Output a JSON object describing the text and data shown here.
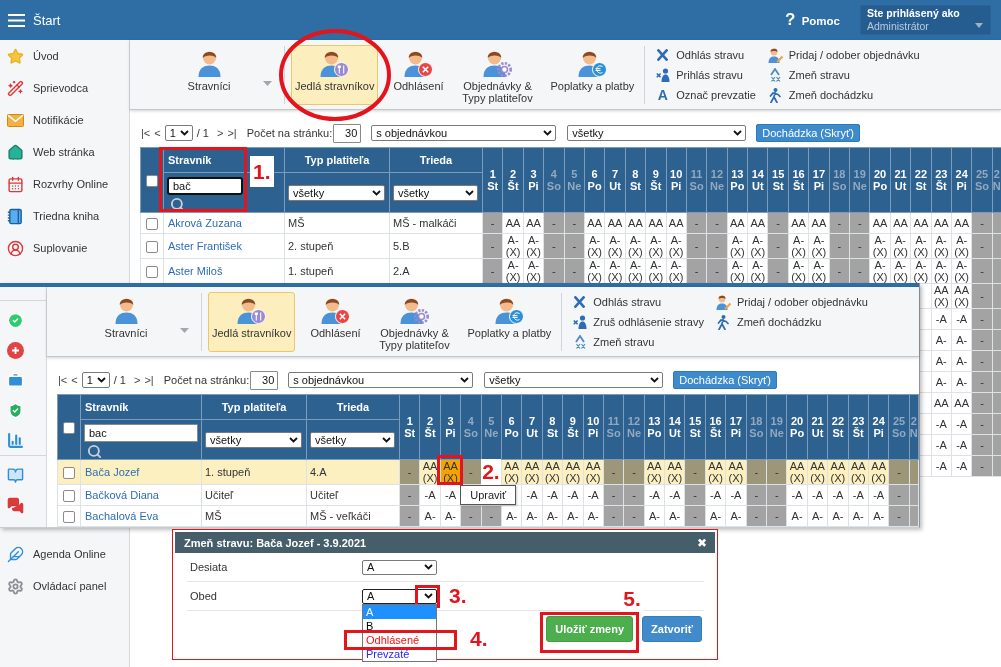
{
  "header": {
    "title": "Štart",
    "help_icon": "?",
    "help": "Pomoc",
    "user_caption": "Ste prihlásený ako",
    "user_name": "Administrátor"
  },
  "sidebar": {
    "items": [
      {
        "label": "Úvod"
      },
      {
        "label": "Sprievodca"
      },
      {
        "label": "Notifikácie"
      },
      {
        "label": "Web stránka"
      },
      {
        "label": "Rozvrhy Online"
      },
      {
        "label": "Triedna kniha"
      },
      {
        "label": "Suplovanie"
      }
    ],
    "bottom_items": [
      {
        "label": "Agenda Online"
      },
      {
        "label": "Ovládací panel"
      }
    ]
  },
  "base": {
    "toolbar": {
      "modules": [
        {
          "label": "Stravníci",
          "selected": false,
          "has_menu": true,
          "circled": false
        },
        {
          "label": "Jedlá stravníkov",
          "selected": true,
          "has_menu": false,
          "circled": true
        },
        {
          "label": "Odhlásení",
          "selected": false,
          "has_menu": false,
          "circled": false
        },
        {
          "label": "Objednávky & Typy platiteľov",
          "selected": false,
          "has_menu": false,
          "circled": false
        },
        {
          "label": "Poplatky a platby",
          "selected": false,
          "has_menu": false,
          "circled": false
        }
      ],
      "actions": [
        [
          {
            "label": "Odhlás stravu",
            "kind": "cancel"
          },
          {
            "label": "Prihlás stravu",
            "kind": "restore"
          },
          {
            "label": "Označ prevzatie",
            "kind": "mark",
            "glyph": "A"
          }
        ],
        [
          {
            "label": "Pridaj / odober objednávku",
            "kind": "order"
          },
          {
            "label": "Zmeň stravu",
            "kind": "change"
          },
          {
            "label": "Zmeň dochádzku",
            "kind": "attendance"
          }
        ]
      ]
    },
    "pager": {
      "first": "|<",
      "prev": "<",
      "page": "1",
      "of": "/ 1",
      "next": ">",
      "last": ">|",
      "per_page_label": "Počet na stránku:",
      "per_page": "30",
      "order_filter": "s objednávkou",
      "status_filter": "všetky",
      "attendance_button": "Dochádzka (Skryť)"
    },
    "table": {
      "columns": {
        "name": "Stravník",
        "payer_type": "Typ platiteľa",
        "class": "Trieda"
      },
      "select_all": false,
      "filters": {
        "name": "bač",
        "focused": true,
        "step": "1.",
        "payer_type": "všetky",
        "class": "všetky"
      },
      "days": [
        {
          "num": "1",
          "dow": "St",
          "kind": "holiday"
        },
        {
          "num": "2",
          "dow": "Št",
          "kind": "workday"
        },
        {
          "num": "3",
          "dow": "Pi",
          "kind": "workday"
        },
        {
          "num": "4",
          "dow": "So",
          "kind": "weekend"
        },
        {
          "num": "5",
          "dow": "Ne",
          "kind": "weekend"
        },
        {
          "num": "6",
          "dow": "Po",
          "kind": "workday"
        },
        {
          "num": "7",
          "dow": "Ut",
          "kind": "workday"
        },
        {
          "num": "8",
          "dow": "St",
          "kind": "workday"
        },
        {
          "num": "9",
          "dow": "Št",
          "kind": "workday"
        },
        {
          "num": "10",
          "dow": "Pi",
          "kind": "workday"
        },
        {
          "num": "11",
          "dow": "So",
          "kind": "weekend"
        },
        {
          "num": "12",
          "dow": "Ne",
          "kind": "weekend"
        },
        {
          "num": "13",
          "dow": "Po",
          "kind": "workday"
        },
        {
          "num": "14",
          "dow": "Ut",
          "kind": "workday"
        },
        {
          "num": "15",
          "dow": "St",
          "kind": "holiday"
        },
        {
          "num": "16",
          "dow": "Št",
          "kind": "workday"
        },
        {
          "num": "17",
          "dow": "Pi",
          "kind": "workday"
        },
        {
          "num": "18",
          "dow": "So",
          "kind": "weekend"
        },
        {
          "num": "19",
          "dow": "Ne",
          "kind": "weekend"
        },
        {
          "num": "20",
          "dow": "Po",
          "kind": "workday"
        },
        {
          "num": "21",
          "dow": "Ut",
          "kind": "workday"
        },
        {
          "num": "22",
          "dow": "St",
          "kind": "workday"
        },
        {
          "num": "23",
          "dow": "Št",
          "kind": "workday"
        },
        {
          "num": "24",
          "dow": "Pi",
          "kind": "workday"
        },
        {
          "num": "25",
          "dow": "So",
          "kind": "weekend"
        },
        {
          "num": "2",
          "dow": "N",
          "kind": "weekend"
        }
      ],
      "rows": [
        {
          "name": "Akrová Zuzana",
          "payer_type": "MŠ",
          "class": "MŠ - malkáči",
          "checked": false,
          "days": [
            "-",
            "AA",
            "AA",
            "-",
            "-",
            "AA",
            "AA",
            "AA",
            "AA",
            "AA",
            "-",
            "-",
            "AA",
            "AA",
            "-",
            "AA",
            "AA",
            "-",
            "-",
            "AA",
            "AA",
            "AA",
            "AA",
            "AA",
            "-"
          ]
        },
        {
          "name": "Aster František",
          "payer_type": "2. stupeň",
          "class": "5.B",
          "checked": false,
          "days": [
            "-",
            "A- (X)",
            "A- (X)",
            "-",
            "-",
            "A- (X)",
            "A- (X)",
            "A- (X)",
            "A- (X)",
            "A- (X)",
            "-",
            "-",
            "A- (X)",
            "A- (X)",
            "-",
            "A- (X)",
            "A- (X)",
            "-",
            "-",
            "A- (X)",
            "A- (X)",
            "A- (X)",
            "A- (X)",
            "A- (X)",
            "-"
          ]
        },
        {
          "name": "Aster Miloš",
          "payer_type": "1. stupeň",
          "class": "2.A",
          "checked": false,
          "days": [
            "-",
            "A- (X)",
            "A- (X)",
            "-",
            "-",
            "A- (X)",
            "A- (X)",
            "A- (X)",
            "A- (X)",
            "A- (X)",
            "-",
            "-",
            "A- (X)",
            "A- (X)",
            "-",
            "A- (X)",
            "A- (X)",
            "-",
            "-",
            "A- (X)",
            "A- (X)",
            "A- (X)",
            "A- (X)",
            "A- (X)",
            "-"
          ]
        }
      ],
      "peek_rows": [
        {
          "days": [
            "AA (X)",
            "AA (X)",
            "-"
          ]
        },
        {
          "days": [
            "-A",
            "-A",
            "-"
          ]
        },
        {
          "days": [
            "A-",
            "A-",
            "-"
          ]
        },
        {
          "days": [
            "A-",
            "A-",
            "-"
          ]
        },
        {
          "days": [
            "A-",
            "A-",
            "-"
          ]
        },
        {
          "days": [
            "AA",
            "AA",
            "-"
          ]
        },
        {
          "days": [
            "-A",
            "-A",
            "-"
          ]
        },
        {
          "days": [
            "-A",
            "-A",
            "-"
          ]
        },
        {
          "days": [
            "-A",
            "-A",
            "-"
          ]
        }
      ]
    }
  },
  "inset_screenshot": {
    "toolbar": {
      "modules": [
        {
          "label": "Stravníci",
          "selected": false,
          "has_menu": true
        },
        {
          "label": "Jedlá stravníkov",
          "selected": true,
          "has_menu": false
        },
        {
          "label": "Odhlásení",
          "selected": false,
          "has_menu": false
        },
        {
          "label": "Objednávky & Typy platiteľov",
          "selected": false,
          "has_menu": false
        },
        {
          "label": "Poplatky a platby",
          "selected": false,
          "has_menu": false
        }
      ],
      "actions": [
        [
          {
            "label": "Odhlás stravu",
            "kind": "cancel"
          },
          {
            "label": "Zruš odhlásenie stravy",
            "kind": "restore"
          },
          {
            "label": "Zmeň stravu",
            "kind": "change"
          }
        ],
        [
          {
            "label": "Pridaj / odober objednávku",
            "kind": "order"
          },
          {
            "label": "Zmeň dochádzku",
            "kind": "attendance"
          }
        ]
      ]
    },
    "pager": {
      "first": "|<",
      "prev": "<",
      "page": "1",
      "of": "/ 1",
      "next": ">",
      "last": ">|",
      "per_page_label": "Počet na stránku:",
      "per_page": "30",
      "order_filter": "s objednávkou",
      "status_filter": "všetky",
      "attendance_button": "Dochádzka (Skryť)"
    },
    "table": {
      "columns": {
        "name": "Stravník",
        "payer_type": "Typ platiteľa",
        "class": "Trieda"
      },
      "select_all": false,
      "filters": {
        "name": "bac",
        "focused": false,
        "payer_type": "všetky",
        "class": "všetky"
      },
      "days": [
        {
          "num": "1",
          "dow": "St",
          "kind": "holiday"
        },
        {
          "num": "2",
          "dow": "Št",
          "kind": "workday"
        },
        {
          "num": "3",
          "dow": "Pi",
          "kind": "workday"
        },
        {
          "num": "4",
          "dow": "So",
          "kind": "weekend"
        },
        {
          "num": "5",
          "dow": "Ne",
          "kind": "weekend"
        },
        {
          "num": "6",
          "dow": "Po",
          "kind": "workday"
        },
        {
          "num": "7",
          "dow": "Ut",
          "kind": "workday"
        },
        {
          "num": "8",
          "dow": "St",
          "kind": "workday"
        },
        {
          "num": "9",
          "dow": "Št",
          "kind": "workday"
        },
        {
          "num": "10",
          "dow": "Pi",
          "kind": "workday"
        },
        {
          "num": "11",
          "dow": "So",
          "kind": "weekend"
        },
        {
          "num": "12",
          "dow": "Ne",
          "kind": "weekend"
        },
        {
          "num": "13",
          "dow": "Po",
          "kind": "workday"
        },
        {
          "num": "14",
          "dow": "Ut",
          "kind": "workday"
        },
        {
          "num": "15",
          "dow": "St",
          "kind": "holiday"
        },
        {
          "num": "16",
          "dow": "Št",
          "kind": "workday"
        },
        {
          "num": "17",
          "dow": "Pi",
          "kind": "workday"
        },
        {
          "num": "18",
          "dow": "So",
          "kind": "weekend"
        },
        {
          "num": "19",
          "dow": "Ne",
          "kind": "weekend"
        },
        {
          "num": "20",
          "dow": "Po",
          "kind": "workday"
        },
        {
          "num": "21",
          "dow": "Ut",
          "kind": "workday"
        },
        {
          "num": "22",
          "dow": "St",
          "kind": "workday"
        },
        {
          "num": "23",
          "dow": "Št",
          "kind": "workday"
        },
        {
          "num": "24",
          "dow": "Pi",
          "kind": "workday"
        },
        {
          "num": "25",
          "dow": "So",
          "kind": "weekend"
        },
        {
          "num": "2",
          "dow": "N",
          "kind": "weekend"
        }
      ],
      "rows": [
        {
          "name": "Bača Jozef",
          "payer_type": "1. stupeň",
          "class": "4.A",
          "checked": false,
          "selected": true,
          "days": [
            {
              "text": "-",
              "hovered": false
            },
            {
              "text": "AA (X)",
              "hovered": false
            },
            {
              "text": "AA (X)",
              "hovered": true,
              "tooltip": "Upraviť",
              "step": "2."
            },
            {
              "text": "-",
              "hovered": false
            },
            {
              "text": "AA (X)",
              "hovered": false
            },
            {
              "text": "AA (X)",
              "hovered": false
            },
            {
              "text": "AA (X)",
              "hovered": false
            },
            {
              "text": "AA (X)",
              "hovered": false
            },
            {
              "text": "AA (X)",
              "hovered": false
            },
            {
              "text": "-",
              "hovered": false
            },
            {
              "text": "-",
              "hovered": false
            },
            {
              "text": "AA (X)",
              "hovered": false
            },
            {
              "text": "AA (X)",
              "hovered": false
            },
            {
              "text": "-",
              "hovered": false
            },
            {
              "text": "AA (X)",
              "hovered": false
            },
            {
              "text": "AA (X)",
              "hovered": false
            },
            {
              "text": "-",
              "hovered": false
            },
            {
              "text": "-",
              "hovered": false
            },
            {
              "text": "AA (X)",
              "hovered": false
            },
            {
              "text": "AA (X)",
              "hovered": false
            },
            {
              "text": "AA (X)",
              "hovered": false
            },
            {
              "text": "AA (X)",
              "hovered": false
            },
            {
              "text": "AA (X)",
              "hovered": false
            },
            {
              "text": "-",
              "hovered": false
            }
          ]
        },
        {
          "name": "Bačková Diana",
          "payer_type": "Učiteľ",
          "class": "Učiteľ",
          "checked": false,
          "selected": false,
          "days": [
            {
              "text": "-",
              "hovered": false
            },
            {
              "text": "-A",
              "hovered": false
            },
            {
              "text": "-A",
              "hovered": false
            },
            {
              "text": "-A",
              "hovered": false
            },
            {
              "text": "-A",
              "hovered": false
            },
            {
              "text": "-A",
              "hovered": false
            },
            {
              "text": "-A",
              "hovered": false
            },
            {
              "text": "-",
              "hovered": false
            },
            {
              "text": "-",
              "hovered": false
            },
            {
              "text": "-A",
              "hovered": false
            },
            {
              "text": "-A",
              "hovered": false
            },
            {
              "text": "-",
              "hovered": false
            },
            {
              "text": "-A",
              "hovered": false
            },
            {
              "text": "-A",
              "hovered": false
            },
            {
              "text": "-",
              "hovered": false
            },
            {
              "text": "-",
              "hovered": false
            },
            {
              "text": "-A",
              "hovered": false
            },
            {
              "text": "-A",
              "hovered": false
            },
            {
              "text": "-A",
              "hovered": false
            },
            {
              "text": "-A",
              "hovered": false
            },
            {
              "text": "-A",
              "hovered": false
            },
            {
              "text": "-",
              "hovered": false
            }
          ]
        },
        {
          "name": "Bachalová Eva",
          "payer_type": "MŠ",
          "class": "MŠ - veľkáči",
          "checked": false,
          "selected": false,
          "days": [
            {
              "text": "-",
              "hovered": false
            },
            {
              "text": "A-",
              "hovered": false
            },
            {
              "text": "A-",
              "hovered": false
            },
            {
              "text": "-",
              "hovered": false
            },
            {
              "text": "-",
              "hovered": false
            },
            {
              "text": "A-",
              "hovered": false
            },
            {
              "text": "A-",
              "hovered": false
            },
            {
              "text": "A-",
              "hovered": false
            },
            {
              "text": "A-",
              "hovered": false
            },
            {
              "text": "A-",
              "hovered": false
            },
            {
              "text": "-",
              "hovered": false
            },
            {
              "text": "-",
              "hovered": false
            },
            {
              "text": "A-",
              "hovered": false
            },
            {
              "text": "A-",
              "hovered": false
            },
            {
              "text": "-",
              "hovered": false
            },
            {
              "text": "A-",
              "hovered": false
            },
            {
              "text": "A-",
              "hovered": false
            },
            {
              "text": "-",
              "hovered": false
            },
            {
              "text": "-",
              "hovered": false
            },
            {
              "text": "A-",
              "hovered": false
            },
            {
              "text": "A-",
              "hovered": false
            },
            {
              "text": "A-",
              "hovered": false
            },
            {
              "text": "A-",
              "hovered": false
            },
            {
              "text": "A-",
              "hovered": false
            },
            {
              "text": "-",
              "hovered": false
            }
          ]
        }
      ]
    }
  },
  "dialog": {
    "title": "Zmeň stravu: Bača Jozef - 3.9.2021",
    "close": "✖",
    "fields": [
      {
        "label": "Desiata",
        "value": "A",
        "expanded": false
      },
      {
        "label": "Obed",
        "value": "A",
        "expanded": true,
        "step": "3.",
        "options": [
          {
            "label": "A",
            "selected": true
          },
          {
            "label": "B",
            "selected": false
          },
          {
            "label": "Odhlásené",
            "selected": false,
            "color": "#ee1111",
            "step": "4."
          },
          {
            "label": "Prevzaté",
            "selected": false,
            "color": "#1f1fff"
          }
        ]
      }
    ],
    "buttons": [
      {
        "label": "Uložiť zmeny",
        "kind": "save",
        "step": "5."
      },
      {
        "label": "Zatvoriť",
        "kind": "close"
      }
    ]
  }
}
